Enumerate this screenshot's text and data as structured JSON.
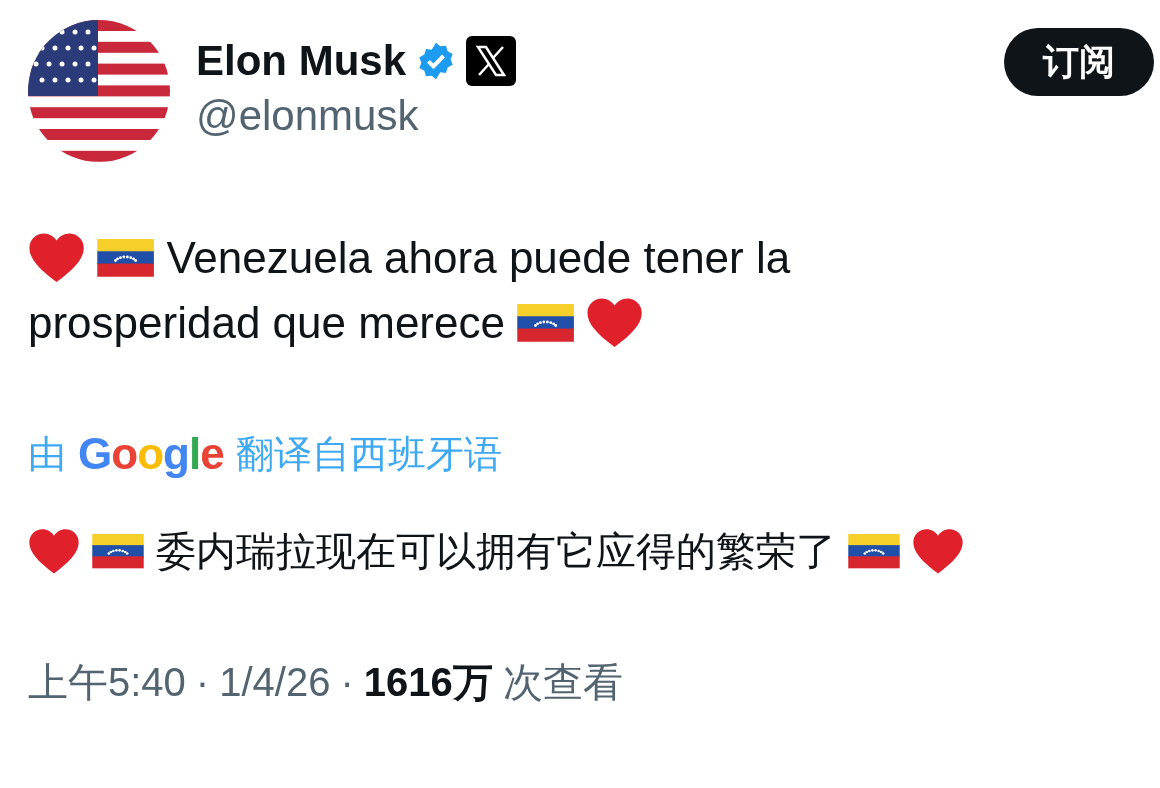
{
  "author": {
    "name": "Elon Musk",
    "verified": true,
    "handle": "@elonmusk"
  },
  "subscribe_button": {
    "label": "订阅"
  },
  "tweet": {
    "lines": [
      [
        {
          "kind": "heart"
        },
        {
          "kind": "flag"
        },
        {
          "kind": "text",
          "text": "Venezuela ahora puede tener la"
        }
      ],
      [
        {
          "kind": "text",
          "text": "prosperidad que merece"
        },
        {
          "kind": "flag"
        },
        {
          "kind": "heart"
        }
      ]
    ]
  },
  "translation": {
    "by": "由",
    "service": "Google",
    "from": "翻译自西班牙语",
    "line": [
      {
        "kind": "heart"
      },
      {
        "kind": "flag"
      },
      {
        "kind": "text",
        "text": "委内瑞拉现在可以拥有它应得的繁荣了"
      },
      {
        "kind": "flag"
      },
      {
        "kind": "heart"
      }
    ]
  },
  "meta": {
    "time": "上午5:40",
    "sep1": "·",
    "date": "1/4/26",
    "sep2": "·",
    "views": "1616万",
    "views_label": "次查看"
  }
}
